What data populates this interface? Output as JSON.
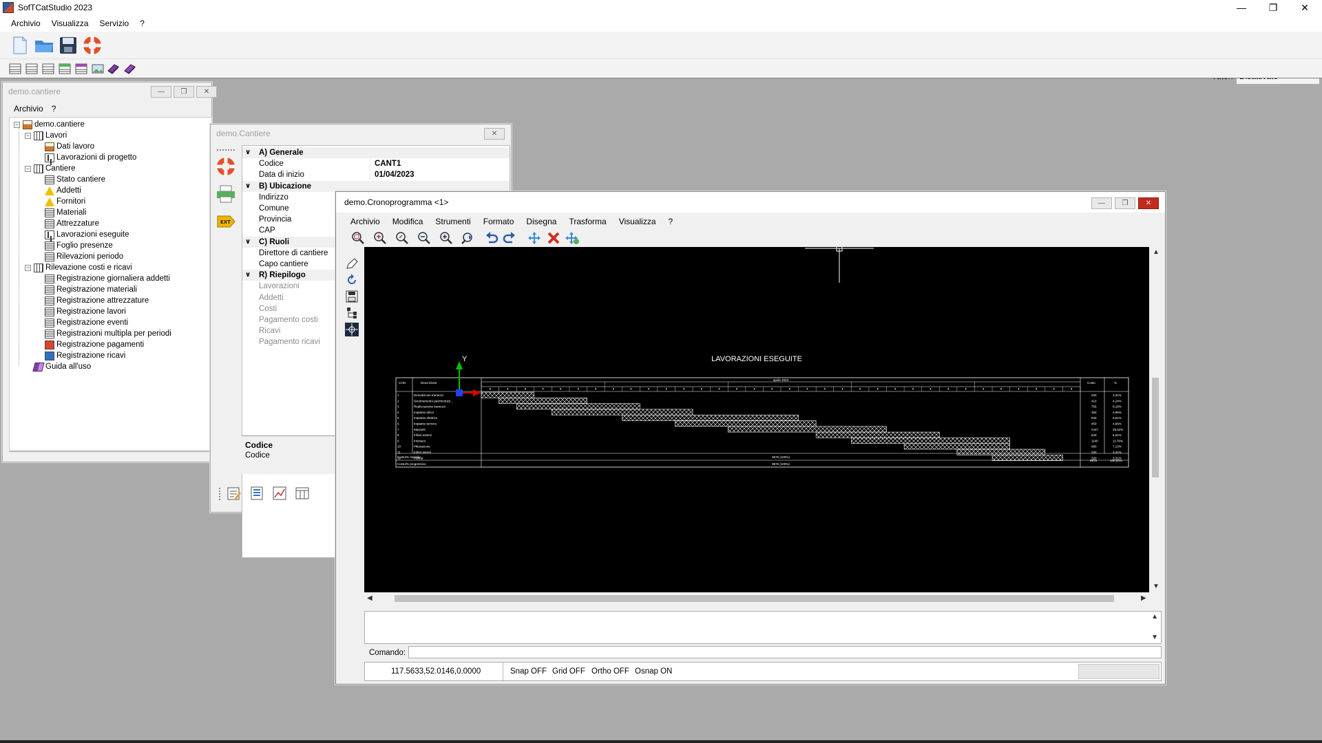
{
  "app": {
    "title": "SofTCatStudio 2023",
    "menu": [
      "Archivio",
      "Visualizza",
      "Servizio",
      "?"
    ],
    "tutor_label": "Tutor:",
    "tutor_value": "Disattivato"
  },
  "tree_window": {
    "title": "demo.cantiere",
    "menu": [
      "Archivio",
      "?"
    ],
    "nodes": [
      {
        "label": "demo.cantiere",
        "level": 0,
        "icon": "home-icon",
        "expander": "−"
      },
      {
        "label": "Lavori",
        "level": 1,
        "icon": "folder-group-icon",
        "expander": "−"
      },
      {
        "label": "Dati lavoro",
        "level": 2,
        "icon": "house-small-icon"
      },
      {
        "label": "Lavorazioni di progetto",
        "level": 2,
        "icon": "flowchart-icon"
      },
      {
        "label": "Cantiere",
        "level": 1,
        "icon": "folder-group-icon",
        "expander": "−"
      },
      {
        "label": "Stato cantiere",
        "level": 2,
        "icon": "document-icon"
      },
      {
        "label": "Addetti",
        "level": 2,
        "icon": "worker-icon"
      },
      {
        "label": "Fornitori",
        "level": 2,
        "icon": "worker-icon"
      },
      {
        "label": "Materiali",
        "level": 2,
        "icon": "materials-icon"
      },
      {
        "label": "Attrezzature",
        "level": 2,
        "icon": "tools-icon"
      },
      {
        "label": "Lavorazioni eseguite",
        "level": 2,
        "icon": "flowchart-icon"
      },
      {
        "label": "Foglio presenze",
        "level": 2,
        "icon": "document-icon"
      },
      {
        "label": "Rilevazioni periodo",
        "level": 2,
        "icon": "document-icon"
      },
      {
        "label": "Rilevazione costi e ricavi",
        "level": 1,
        "icon": "folder-group-icon",
        "expander": "−"
      },
      {
        "label": "Registrazione giornaliera addetti",
        "level": 2,
        "icon": "document-icon"
      },
      {
        "label": "Registrazione materiali",
        "level": 2,
        "icon": "document-icon"
      },
      {
        "label": "Registrazione attrezzature",
        "level": 2,
        "icon": "document-icon"
      },
      {
        "label": "Registrazione lavori",
        "level": 2,
        "icon": "document-icon"
      },
      {
        "label": "Registrazione eventi",
        "level": 2,
        "icon": "document-icon"
      },
      {
        "label": "Registrazioni multipla per periodi",
        "level": 2,
        "icon": "document-icon"
      },
      {
        "label": "Registrazione pagamenti",
        "level": 2,
        "icon": "payment-icon"
      },
      {
        "label": "Registrazione ricavi",
        "level": 2,
        "icon": "revenue-icon"
      },
      {
        "label": "Guida all'uso",
        "level": 1,
        "icon": "book-icon"
      }
    ]
  },
  "prop_window": {
    "title": "demo.Cantiere",
    "rows": [
      {
        "type": "cat",
        "label": "A) Generale"
      },
      {
        "type": "row",
        "label": "Codice",
        "value": "CANT1"
      },
      {
        "type": "row",
        "label": "Data di inizio",
        "value": "01/04/2023"
      },
      {
        "type": "cat",
        "label": "B) Ubicazione"
      },
      {
        "type": "row",
        "label": "Indirizzo",
        "value": ""
      },
      {
        "type": "row",
        "label": "Comune",
        "value": ""
      },
      {
        "type": "row",
        "label": "Provincia",
        "value": ""
      },
      {
        "type": "row",
        "label": "CAP",
        "value": ""
      },
      {
        "type": "cat",
        "label": "C) Ruoli"
      },
      {
        "type": "row",
        "label": "Direttore di cantiere",
        "value": ""
      },
      {
        "type": "row",
        "label": "Capo cantiere",
        "value": ""
      },
      {
        "type": "cat",
        "label": "R) Riepilogo"
      },
      {
        "type": "dis",
        "label": "Lavorazioni",
        "value": ""
      },
      {
        "type": "dis",
        "label": "Addetti",
        "value": ""
      },
      {
        "type": "dis",
        "label": "Costi",
        "value": ""
      },
      {
        "type": "dis",
        "label": "Pagamento costi",
        "value": ""
      },
      {
        "type": "dis",
        "label": "Ricavi",
        "value": ""
      },
      {
        "type": "dis",
        "label": "Pagamento ricavi",
        "value": ""
      }
    ],
    "desc_title": "Codice",
    "desc_text": "Codice"
  },
  "crono_window": {
    "title": "demo.Cronoprogramma <1>",
    "menu": [
      "Archivio",
      "Modifica",
      "Strumenti",
      "Formato",
      "Disegna",
      "Trasforma",
      "Visualizza",
      "?"
    ],
    "drawing": {
      "title": "LAVORAZIONI ESEGUITE",
      "axis_label": "Y",
      "header_cod": "COD.",
      "header_desc": "Descrizione",
      "header_costo": "Costo",
      "header_pct": "%",
      "month_label": "aprile 2023",
      "rows": [
        {
          "cod": "1",
          "desc": "Demolizione tramezzi",
          "costo": "220",
          "pct": "3,31%",
          "start": 0,
          "dur": 3
        },
        {
          "cod": "2",
          "desc": "Sventramento pavimentazi...",
          "costo": "410",
          "pct": "4,24%",
          "start": 1,
          "dur": 5
        },
        {
          "cod": "3",
          "desc": "Realizzazione tramezzi",
          "costo": "755",
          "pct": "8,18%",
          "start": 2,
          "dur": 7
        },
        {
          "cod": "4",
          "desc": "Impianto idrico",
          "costo": "450",
          "pct": "4,96%",
          "start": 4,
          "dur": 8
        },
        {
          "cod": "5",
          "desc": "Impianto elettrico",
          "costo": "840",
          "pct": "6,61%",
          "start": 8,
          "dur": 10
        },
        {
          "cod": "6",
          "desc": "Impianto termico",
          "costo": "450",
          "pct": "4,96%",
          "start": 11,
          "dur": 8
        },
        {
          "cod": "7",
          "desc": "Massetti",
          "costo": "2447",
          "pct": "25,62%",
          "start": 14,
          "dur": 9
        },
        {
          "cod": "8",
          "desc": "Infissi esterni",
          "costo": "640",
          "pct": "6,61%",
          "start": 19,
          "dur": 7
        },
        {
          "cod": "9",
          "desc": "Intonaco",
          "costo": "1140",
          "pct": "11,78%",
          "start": 21,
          "dur": 9
        },
        {
          "cod": "10",
          "desc": "Pitturazione",
          "costo": "690",
          "pct": "7,13%",
          "start": 24,
          "dur": 6
        },
        {
          "cod": "11",
          "desc": "Infissi interni",
          "costo": "320",
          "pct": "3,31%",
          "start": 27,
          "dur": 5
        },
        {
          "cod": "12",
          "desc": "Pulizia",
          "costo": "320",
          "pct": "3,31%",
          "start": 29,
          "dur": 4
        }
      ],
      "total_label_1": "Costo/% mensile",
      "total_label_2": "Costo/% progressivo",
      "total_mid_1": "9676 (100%)",
      "total_mid_2": "9676 (100%)",
      "total_costo": "9676",
      "total_pct": "100,00%"
    },
    "cmd_label": "Comando:",
    "status": {
      "coords": "117.5633,52.0146,0.0000",
      "snap": "Snap OFF",
      "grid": "Grid OFF",
      "ortho": "Ortho OFF",
      "osnap": "Osnap ON"
    }
  },
  "colors": {
    "desktop": "#aaaaaa",
    "canvas": "#000000",
    "close_red": "#c42b1c",
    "axis_green": "#00c000",
    "axis_red": "#e00000",
    "axis_blue": "#2040ff"
  }
}
